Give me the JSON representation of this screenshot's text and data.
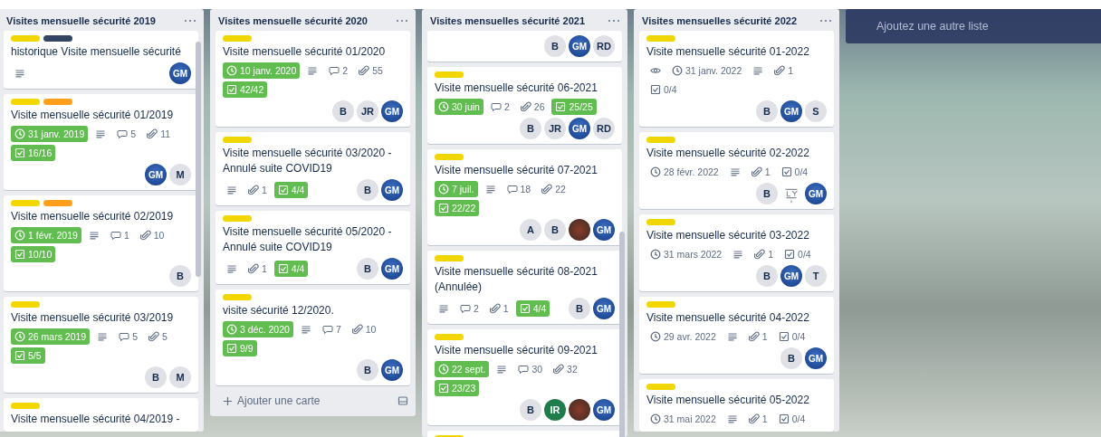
{
  "lists": [
    {
      "title": "Visites mensuelle sécurité 2019",
      "scrollbar": true,
      "cards": [
        {
          "labels": [
            {
              "color": "#f2d600"
            },
            {
              "color": "#344563"
            }
          ],
          "title": "historique Visite mensuelle sécurité",
          "badges": [
            {
              "kind": "description"
            }
          ],
          "members": [
            {
              "kind": "logo",
              "text": "GM"
            }
          ]
        },
        {
          "labels": [
            {
              "color": "#f2d600"
            },
            {
              "color": "#ff9f1a"
            }
          ],
          "title": "Visite mensuelle sécurité 01/2019",
          "badges": [
            {
              "kind": "due",
              "text": "31 janv. 2019",
              "complete": true
            },
            {
              "kind": "description"
            },
            {
              "kind": "comments",
              "text": "5"
            },
            {
              "kind": "attachments",
              "text": "11"
            },
            {
              "kind": "checklist",
              "text": "16/16",
              "complete": true
            }
          ],
          "members": [
            {
              "kind": "logo",
              "text": "GM"
            },
            {
              "kind": "initials",
              "text": "M"
            }
          ]
        },
        {
          "labels": [
            {
              "color": "#f2d600"
            },
            {
              "color": "#ff9f1a"
            }
          ],
          "title": "Visite mensuelle sécurité 02/2019",
          "badges": [
            {
              "kind": "due",
              "text": "1 févr. 2019",
              "complete": true
            },
            {
              "kind": "description"
            },
            {
              "kind": "comments",
              "text": "1"
            },
            {
              "kind": "attachments",
              "text": "10"
            },
            {
              "kind": "checklist",
              "text": "10/10",
              "complete": true
            }
          ],
          "members": [
            {
              "kind": "initials",
              "text": "B"
            }
          ]
        },
        {
          "labels": [
            {
              "color": "#f2d600"
            }
          ],
          "title": "Visite mensuelle sécurité 03/2019",
          "badges": [
            {
              "kind": "due",
              "text": "26 mars 2019",
              "complete": true
            },
            {
              "kind": "description"
            },
            {
              "kind": "comments",
              "text": "5"
            },
            {
              "kind": "attachments",
              "text": "5"
            },
            {
              "kind": "checklist",
              "text": "5/5",
              "complete": true
            }
          ],
          "members": [
            {
              "kind": "initials",
              "text": "B"
            },
            {
              "kind": "initials",
              "text": "M"
            }
          ]
        },
        {
          "labels": [
            {
              "color": "#f2d600"
            }
          ],
          "title": "Visite mensuelle sécurité 04/2019 -"
        }
      ]
    },
    {
      "title": "Visites mensuelle sécurité 2020",
      "composer": "Ajouter une carte",
      "cards": [
        {
          "labels": [
            {
              "color": "#f2d600"
            }
          ],
          "title": "Visite mensuelle sécurité 01/2020",
          "badges": [
            {
              "kind": "due",
              "text": "10 janv. 2020",
              "complete": true
            },
            {
              "kind": "description"
            },
            {
              "kind": "comments",
              "text": "2"
            },
            {
              "kind": "attachments",
              "text": "55"
            },
            {
              "kind": "checklist",
              "text": "42/42",
              "complete": true
            }
          ],
          "members": [
            {
              "kind": "initials",
              "text": "B"
            },
            {
              "kind": "initials",
              "text": "JR"
            },
            {
              "kind": "logo",
              "text": "GM"
            }
          ]
        },
        {
          "labels": [
            {
              "color": "#f2d600"
            }
          ],
          "title": "Visite mensuelle sécurité 03/2020 - Annulé suite COVID19",
          "badges": [
            {
              "kind": "description"
            },
            {
              "kind": "attachments",
              "text": "1"
            },
            {
              "kind": "checklist",
              "text": "4/4",
              "complete": true
            }
          ],
          "members": [
            {
              "kind": "initials",
              "text": "B"
            },
            {
              "kind": "logo",
              "text": "GM"
            }
          ]
        },
        {
          "labels": [
            {
              "color": "#f2d600"
            }
          ],
          "title": "Visite mensuelle sécurité 05/2020 - Annulé suite COVID19",
          "badges": [
            {
              "kind": "description"
            },
            {
              "kind": "attachments",
              "text": "1"
            },
            {
              "kind": "checklist",
              "text": "4/4",
              "complete": true
            }
          ],
          "members": [
            {
              "kind": "initials",
              "text": "B"
            },
            {
              "kind": "logo",
              "text": "GM"
            }
          ]
        },
        {
          "labels": [
            {
              "color": "#f2d600"
            }
          ],
          "title": "visite sécurité 12/2020.",
          "badges": [
            {
              "kind": "due",
              "text": "3 déc. 2020",
              "complete": true
            },
            {
              "kind": "description"
            },
            {
              "kind": "comments",
              "text": "7"
            },
            {
              "kind": "attachments",
              "text": "10"
            },
            {
              "kind": "checklist",
              "text": "9/9",
              "complete": true
            }
          ],
          "members": [
            {
              "kind": "initials",
              "text": "B"
            },
            {
              "kind": "logo",
              "text": "GM"
            }
          ]
        }
      ]
    },
    {
      "title": "Visites mensuelles sécurité 2021",
      "scrollbar": true,
      "cards": [
        {
          "members": [
            {
              "kind": "initials",
              "text": "B"
            },
            {
              "kind": "logo",
              "text": "GM"
            },
            {
              "kind": "initials",
              "text": "RD"
            }
          ]
        },
        {
          "labels": [
            {
              "color": "#f2d600"
            }
          ],
          "title": "Visite mensuelle sécurité 06-2021",
          "badges": [
            {
              "kind": "due",
              "text": "30 juin",
              "complete": true
            },
            {
              "kind": "comments",
              "text": "2"
            },
            {
              "kind": "attachments",
              "text": "26"
            },
            {
              "kind": "checklist",
              "text": "25/25",
              "complete": true
            }
          ],
          "members": [
            {
              "kind": "initials",
              "text": "B"
            },
            {
              "kind": "initials",
              "text": "JR"
            },
            {
              "kind": "logo",
              "text": "GM"
            },
            {
              "kind": "initials",
              "text": "RD"
            }
          ]
        },
        {
          "labels": [
            {
              "color": "#f2d600"
            }
          ],
          "title": "Visite mensuelle sécurité 07-2021",
          "badges": [
            {
              "kind": "due",
              "text": "7 juil.",
              "complete": true
            },
            {
              "kind": "description"
            },
            {
              "kind": "comments",
              "text": "18"
            },
            {
              "kind": "attachments",
              "text": "22"
            },
            {
              "kind": "checklist",
              "text": "22/22",
              "complete": true
            }
          ],
          "members": [
            {
              "kind": "initials",
              "text": "A"
            },
            {
              "kind": "initials",
              "text": "B"
            },
            {
              "kind": "photo"
            },
            {
              "kind": "logo",
              "text": "GM"
            }
          ]
        },
        {
          "labels": [
            {
              "color": "#f2d600"
            }
          ],
          "title": "Visite mensuelle sécurité 08-2021 (Annulée)",
          "badges": [
            {
              "kind": "description"
            },
            {
              "kind": "comments",
              "text": "2"
            },
            {
              "kind": "attachments",
              "text": "1"
            },
            {
              "kind": "checklist",
              "text": "4/4",
              "complete": true
            }
          ],
          "members": [
            {
              "kind": "initials",
              "text": "B"
            },
            {
              "kind": "logo",
              "text": "GM"
            }
          ]
        },
        {
          "labels": [
            {
              "color": "#f2d600"
            }
          ],
          "title": "Visite mensuelle sécurité 09-2021",
          "badges": [
            {
              "kind": "due",
              "text": "22 sept.",
              "complete": true
            },
            {
              "kind": "description"
            },
            {
              "kind": "comments",
              "text": "30"
            },
            {
              "kind": "attachments",
              "text": "32"
            },
            {
              "kind": "checklist",
              "text": "23/23",
              "complete": true
            }
          ],
          "members": [
            {
              "kind": "initials",
              "text": "B"
            },
            {
              "kind": "initials",
              "text": "IR",
              "color": "#1e7d4a"
            },
            {
              "kind": "photo"
            },
            {
              "kind": "logo",
              "text": "GM"
            }
          ]
        },
        {
          "labels": [
            {
              "color": "#f2d600"
            }
          ]
        }
      ]
    },
    {
      "title": "Visites mensuelles sécurité 2022",
      "cards": [
        {
          "labels": [
            {
              "color": "#f2d600"
            }
          ],
          "title": "Visite mensuelle sécurité 01-2022",
          "badges": [
            {
              "kind": "watch"
            },
            {
              "kind": "due",
              "text": "31 janv. 2022",
              "complete": false
            },
            {
              "kind": "description"
            },
            {
              "kind": "attachments",
              "text": "1"
            },
            {
              "kind": "checklist",
              "text": "0/4",
              "complete": false
            }
          ],
          "members": [
            {
              "kind": "initials",
              "text": "B"
            },
            {
              "kind": "logo",
              "text": "GM"
            },
            {
              "kind": "initials",
              "text": "S"
            }
          ]
        },
        {
          "labels": [
            {
              "color": "#f2d600"
            }
          ],
          "title": "Visite mensuelle sécurité 02-2022",
          "badges": [
            {
              "kind": "due",
              "text": "28 févr. 2022",
              "complete": false
            },
            {
              "kind": "description"
            },
            {
              "kind": "attachments",
              "text": "1"
            },
            {
              "kind": "checklist",
              "text": "0/4",
              "complete": false
            }
          ],
          "members": [
            {
              "kind": "initials",
              "text": "B"
            },
            {
              "kind": "emblem"
            },
            {
              "kind": "logo",
              "text": "GM"
            }
          ]
        },
        {
          "labels": [
            {
              "color": "#f2d600"
            }
          ],
          "title": "Visite mensuelle sécurité 03-2022",
          "badges": [
            {
              "kind": "due",
              "text": "31 mars 2022",
              "complete": false
            },
            {
              "kind": "description"
            },
            {
              "kind": "attachments",
              "text": "1"
            },
            {
              "kind": "checklist",
              "text": "0/4",
              "complete": false
            }
          ],
          "members": [
            {
              "kind": "initials",
              "text": "B"
            },
            {
              "kind": "logo",
              "text": "GM"
            },
            {
              "kind": "initials",
              "text": "T"
            }
          ]
        },
        {
          "labels": [
            {
              "color": "#f2d600"
            }
          ],
          "title": "Visite mensuelle sécurité 04-2022",
          "badges": [
            {
              "kind": "due",
              "text": "29 avr. 2022",
              "complete": false
            },
            {
              "kind": "description"
            },
            {
              "kind": "attachments",
              "text": "1"
            },
            {
              "kind": "checklist",
              "text": "0/4",
              "complete": false
            }
          ],
          "members": [
            {
              "kind": "initials",
              "text": "B"
            },
            {
              "kind": "logo",
              "text": "GM"
            }
          ]
        },
        {
          "labels": [
            {
              "color": "#f2d600"
            }
          ],
          "title": "Visite mensuelle sécurité 05-2022",
          "badges": [
            {
              "kind": "due",
              "text": "31 mai 2022",
              "complete": false
            },
            {
              "kind": "description"
            },
            {
              "kind": "attachments",
              "text": "1"
            },
            {
              "kind": "checklist",
              "text": "0/4",
              "complete": false
            }
          ]
        }
      ]
    }
  ],
  "add_list": "Ajoutez une autre liste"
}
